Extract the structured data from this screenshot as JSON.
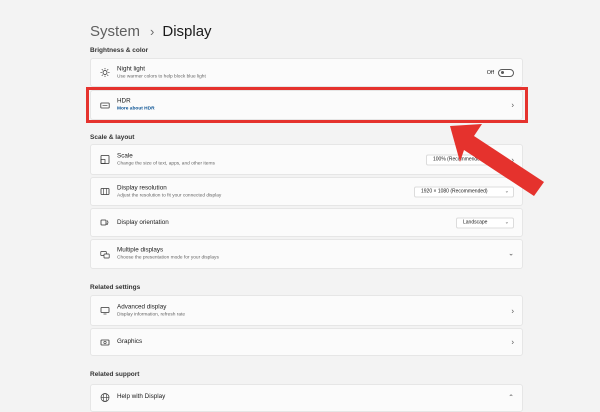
{
  "breadcrumb": {
    "parent": "System",
    "separator": "›",
    "current": "Display"
  },
  "sections": {
    "brightness": "Brightness & color",
    "scale_layout": "Scale & layout",
    "related_settings": "Related settings",
    "related_support": "Related support"
  },
  "night_light": {
    "title": "Night light",
    "subtitle": "Use warmer colors to help block blue light",
    "toggle_label": "Off",
    "toggle_state": "off"
  },
  "hdr": {
    "title": "HDR",
    "link": "More about HDR"
  },
  "scale": {
    "title": "Scale",
    "subtitle": "Change the size of text, apps, and other items",
    "value": "100% (Recommended)"
  },
  "resolution": {
    "title": "Display resolution",
    "subtitle": "Adjust the resolution to fit your connected display",
    "value": "1920 × 1080 (Recommended)"
  },
  "orientation": {
    "title": "Display orientation",
    "value": "Landscape"
  },
  "multiple_displays": {
    "title": "Multiple displays",
    "subtitle": "Choose the presentation mode for your displays"
  },
  "advanced_display": {
    "title": "Advanced display",
    "subtitle": "Display information, refresh rate"
  },
  "graphics": {
    "title": "Graphics"
  },
  "help_display": {
    "title": "Help with Display"
  },
  "icons": {
    "night_light": "sun-icon",
    "hdr": "hdr-icon",
    "scale": "scale-icon",
    "resolution": "resolution-icon",
    "orientation": "orientation-icon",
    "multiple_displays": "multiple-displays-icon",
    "advanced_display": "monitor-icon",
    "graphics": "graphics-icon",
    "help": "globe-icon"
  },
  "colors": {
    "highlight": "#e5322d",
    "link": "#0b5394",
    "background": "#f3f3f3"
  }
}
